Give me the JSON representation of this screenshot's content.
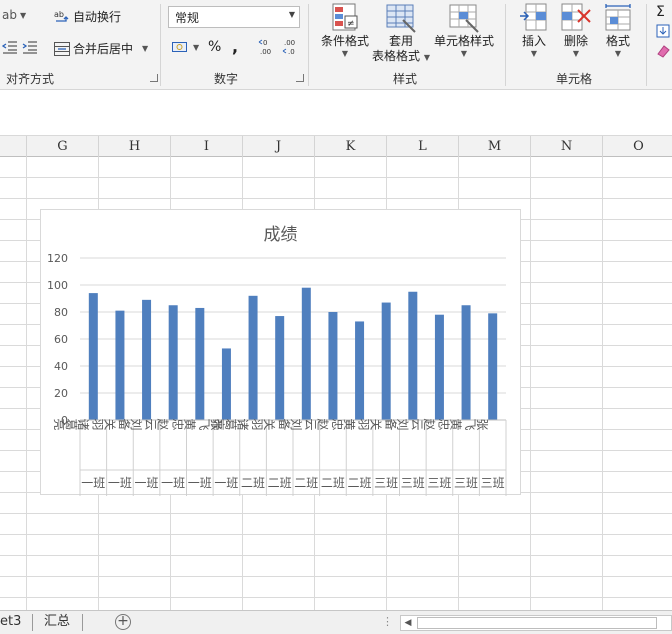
{
  "ribbon": {
    "alignment": {
      "wrap_text_label": "自动换行",
      "merge_center_label": "合并后居中",
      "group_label": "对齐方式"
    },
    "number": {
      "format_value": "常规",
      "percent_symbol": "%",
      "comma_symbol": ",",
      "group_label": "数字"
    },
    "styles": {
      "conditional_format_label": "条件格式",
      "table_format_label_line1": "套用",
      "table_format_label_line2": "表格格式",
      "cell_styles_label": "单元格样式",
      "group_label": "样式"
    },
    "cells": {
      "insert_label": "插入",
      "delete_label": "删除",
      "format_label": "格式",
      "group_label": "单元格"
    }
  },
  "columns": [
    "G",
    "H",
    "I",
    "J",
    "K",
    "L",
    "M",
    "N",
    "O"
  ],
  "sheet_tabs": [
    {
      "label": "et3"
    },
    {
      "label": "汇总"
    }
  ],
  "colors": {
    "bar": "#4f7fbe",
    "gridline": "#d9d9d9",
    "axis_text": "#595959"
  },
  "chart_data": {
    "type": "bar",
    "title": "成绩",
    "ylim": [
      0,
      120
    ],
    "yticks": [
      0,
      20,
      40,
      60,
      80,
      100,
      120
    ],
    "categories": [
      {
        "name": "诸葛亮",
        "group": "一班"
      },
      {
        "name": "关羽",
        "group": "一班"
      },
      {
        "name": "刘备",
        "group": "一班"
      },
      {
        "name": "赵云",
        "group": "一班"
      },
      {
        "name": "黄忠",
        "group": "一班"
      },
      {
        "name": "张飞",
        "group": "一班"
      },
      {
        "name": "诸葛亮",
        "group": "二班"
      },
      {
        "name": "关羽",
        "group": "二班"
      },
      {
        "name": "刘备",
        "group": "二班"
      },
      {
        "name": "赵云",
        "group": "二班"
      },
      {
        "name": "黄忠",
        "group": "二班"
      },
      {
        "name": "关羽",
        "group": "三班"
      },
      {
        "name": "刘备",
        "group": "三班"
      },
      {
        "name": "赵云",
        "group": "三班"
      },
      {
        "name": "黄忠",
        "group": "三班"
      },
      {
        "name": "张飞",
        "group": "三班"
      }
    ],
    "values": [
      94,
      81,
      89,
      85,
      83,
      53,
      92,
      77,
      98,
      80,
      73,
      87,
      95,
      78,
      85,
      79
    ],
    "grid": true,
    "legend": "none"
  }
}
